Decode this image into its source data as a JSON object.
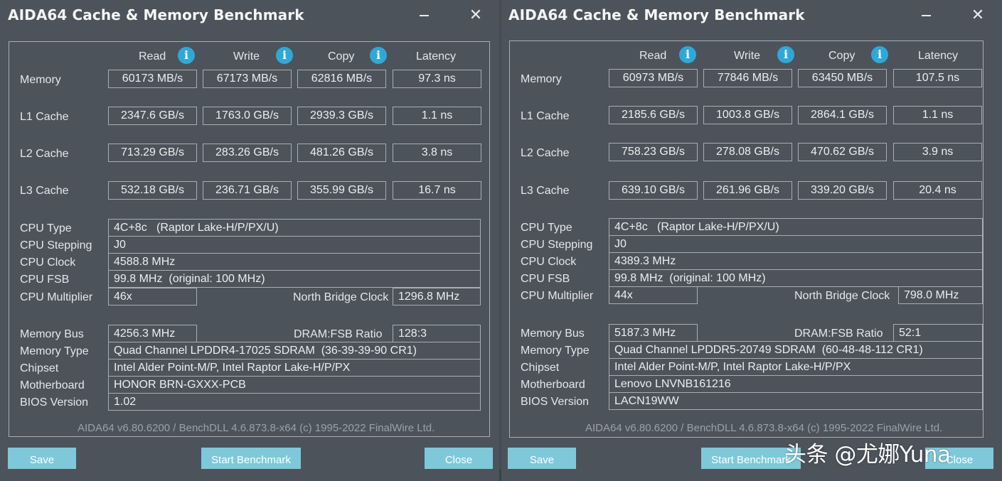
{
  "windows": [
    {
      "title": "AIDA64 Cache & Memory Benchmark",
      "controls": {
        "minimize": "minimize",
        "close": "✕"
      },
      "columns": [
        "Read",
        "Write",
        "Copy",
        "Latency"
      ],
      "rows": [
        {
          "label": "Memory",
          "read": "60173 MB/s",
          "write": "67173 MB/s",
          "copy": "62816 MB/s",
          "latency": "97.3 ns"
        },
        {
          "label": "L1 Cache",
          "read": "2347.6 GB/s",
          "write": "1763.0 GB/s",
          "copy": "2939.3 GB/s",
          "latency": "1.1 ns"
        },
        {
          "label": "L2 Cache",
          "read": "713.29 GB/s",
          "write": "283.26 GB/s",
          "copy": "481.26 GB/s",
          "latency": "3.8 ns"
        },
        {
          "label": "L3 Cache",
          "read": "532.18 GB/s",
          "write": "236.71 GB/s",
          "copy": "355.99 GB/s",
          "latency": "16.7 ns"
        }
      ],
      "cpu": {
        "type_label": "CPU Type",
        "type": "4C+8c   (Raptor Lake-H/P/PX/U)",
        "stepping_label": "CPU Stepping",
        "stepping": "J0",
        "clock_label": "CPU Clock",
        "clock": "4588.8 MHz",
        "fsb_label": "CPU FSB",
        "fsb": "99.8 MHz  (original: 100 MHz)",
        "multiplier_label": "CPU Multiplier",
        "multiplier": "46x",
        "nb_clock_label": "North Bridge Clock",
        "nb_clock": "1296.8 MHz"
      },
      "mem": {
        "bus_label": "Memory Bus",
        "bus": "4256.3 MHz",
        "ratio_label": "DRAM:FSB Ratio",
        "ratio": "128:3",
        "type_label": "Memory Type",
        "type": "Quad Channel LPDDR4-17025 SDRAM  (36-39-39-90 CR1)",
        "chipset_label": "Chipset",
        "chipset": "Intel Alder Point-M/P, Intel Raptor Lake-H/P/PX",
        "mobo_label": "Motherboard",
        "mobo": "HONOR BRN-GXXX-PCB",
        "bios_label": "BIOS Version",
        "bios": "1.02"
      },
      "footer": "AIDA64 v6.80.6200 / BenchDLL 4.6.873.8-x64  (c) 1995-2022 FinalWire Ltd.",
      "buttons": {
        "save": "Save",
        "start": "Start Benchmark",
        "close": "Close"
      }
    },
    {
      "title": "AIDA64 Cache & Memory Benchmark",
      "controls": {
        "minimize": "minimize",
        "close": "✕"
      },
      "columns": [
        "Read",
        "Write",
        "Copy",
        "Latency"
      ],
      "rows": [
        {
          "label": "Memory",
          "read": "60973 MB/s",
          "write": "77846 MB/s",
          "copy": "63450 MB/s",
          "latency": "107.5 ns"
        },
        {
          "label": "L1 Cache",
          "read": "2185.6 GB/s",
          "write": "1003.8 GB/s",
          "copy": "2864.1 GB/s",
          "latency": "1.1 ns"
        },
        {
          "label": "L2 Cache",
          "read": "758.23 GB/s",
          "write": "278.08 GB/s",
          "copy": "470.62 GB/s",
          "latency": "3.9 ns"
        },
        {
          "label": "L3 Cache",
          "read": "639.10 GB/s",
          "write": "261.96 GB/s",
          "copy": "339.20 GB/s",
          "latency": "20.4 ns"
        }
      ],
      "cpu": {
        "type_label": "CPU Type",
        "type": "4C+8c   (Raptor Lake-H/P/PX/U)",
        "stepping_label": "CPU Stepping",
        "stepping": "J0",
        "clock_label": "CPU Clock",
        "clock": "4389.3 MHz",
        "fsb_label": "CPU FSB",
        "fsb": "99.8 MHz  (original: 100 MHz)",
        "multiplier_label": "CPU Multiplier",
        "multiplier": "44x",
        "nb_clock_label": "North Bridge Clock",
        "nb_clock": "798.0 MHz"
      },
      "mem": {
        "bus_label": "Memory Bus",
        "bus": "5187.3 MHz",
        "ratio_label": "DRAM:FSB Ratio",
        "ratio": "52:1",
        "type_label": "Memory Type",
        "type": "Quad Channel LPDDR5-20749 SDRAM  (60-48-48-112 CR1)",
        "chipset_label": "Chipset",
        "chipset": "Intel Alder Point-M/P, Intel Raptor Lake-H/P/PX",
        "mobo_label": "Motherboard",
        "mobo": "Lenovo LNVNB161216",
        "bios_label": "BIOS Version",
        "bios": "LACN19WW"
      },
      "footer": "AIDA64 v6.80.6200 / BenchDLL 4.6.873.8-x64  (c) 1995-2022 FinalWire Ltd.",
      "buttons": {
        "save": "Save",
        "start": "Start Benchmark",
        "close": "Close"
      }
    }
  ],
  "watermark": "头条 @尤娜Yuna",
  "colors": {
    "window_bg": "#4d535b",
    "border": "#a9aeb5",
    "button": "#7ec8da",
    "info_icon": "#2fa8d8"
  }
}
